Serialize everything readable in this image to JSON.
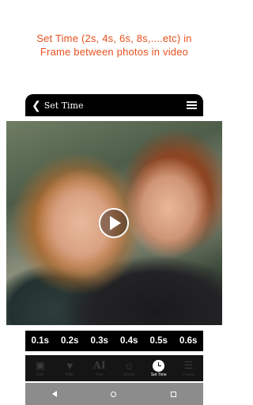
{
  "promo": {
    "line1": "Set Time (2s, 4s, 6s, 8s,....etc) in",
    "line2": "Frame between photos in video"
  },
  "header": {
    "back_icon": "chevron-left-icon",
    "title": "Set Time",
    "menu_icon": "list-icon"
  },
  "photo": {
    "play_icon": "play-icon"
  },
  "times": [
    "0.1s",
    "0.2s",
    "0.3s",
    "0.4s",
    "0.5s",
    "0.6s"
  ],
  "toolbar": {
    "items": [
      {
        "icon": "image-icon",
        "label": "Edit"
      },
      {
        "icon": "filter-icon",
        "label": "Filter"
      },
      {
        "icon": "text-icon",
        "label": "Text"
      },
      {
        "icon": "sticker-icon",
        "label": "Sticker"
      },
      {
        "icon": "clock-icon",
        "label": "Set Time"
      },
      {
        "icon": "layers-icon",
        "label": "Frame"
      }
    ],
    "active_index": 4
  },
  "colors": {
    "promo_text": "#e8501e",
    "bar_background": "#000000",
    "navbar": "#8c8c8c"
  }
}
